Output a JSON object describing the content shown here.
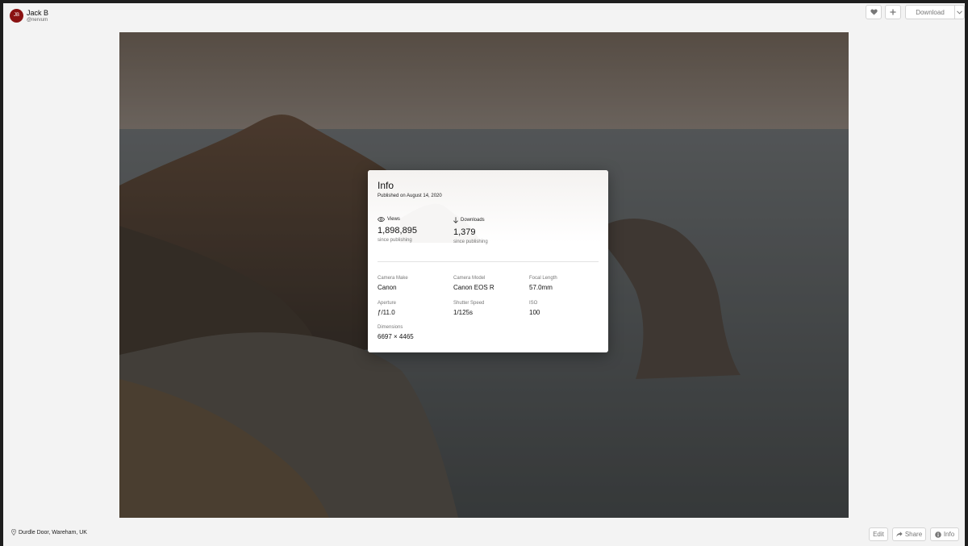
{
  "header": {
    "avatar_initials": "JB",
    "author_name": "Jack B",
    "author_handle": "@nervum",
    "download_label": "Download"
  },
  "icons": {
    "like": "heart-icon",
    "add": "plus-icon",
    "caret": "chevron-down-icon",
    "location": "location-pin-icon",
    "share": "share-icon",
    "info": "info-icon",
    "views": "eye-icon",
    "downloads": "arrow-down-icon"
  },
  "footer": {
    "location": "Durdle Door, Wareham, UK",
    "edit_label": "Edit",
    "share_label": "Share",
    "info_label": "Info"
  },
  "info_modal": {
    "title": "Info",
    "published": "Published on August 14, 2020",
    "views": {
      "label": "Views",
      "value": "1,898,895",
      "note": "since publishing"
    },
    "downloads": {
      "label": "Downloads",
      "value": "1,379",
      "note": "since publishing"
    },
    "specs": [
      {
        "label": "Camera Make",
        "value": "Canon"
      },
      {
        "label": "Camera Model",
        "value": "Canon EOS R"
      },
      {
        "label": "Focal Length",
        "value": "57.0mm"
      },
      {
        "label": "Aperture",
        "value": "ƒ/11.0"
      },
      {
        "label": "Shutter Speed",
        "value": "1/125s"
      },
      {
        "label": "ISO",
        "value": "100"
      },
      {
        "label": "Dimensions",
        "value": "6697 × 4465"
      }
    ]
  },
  "colors": {
    "avatar": "#8a1212",
    "page_background": "#f3f3f3"
  }
}
